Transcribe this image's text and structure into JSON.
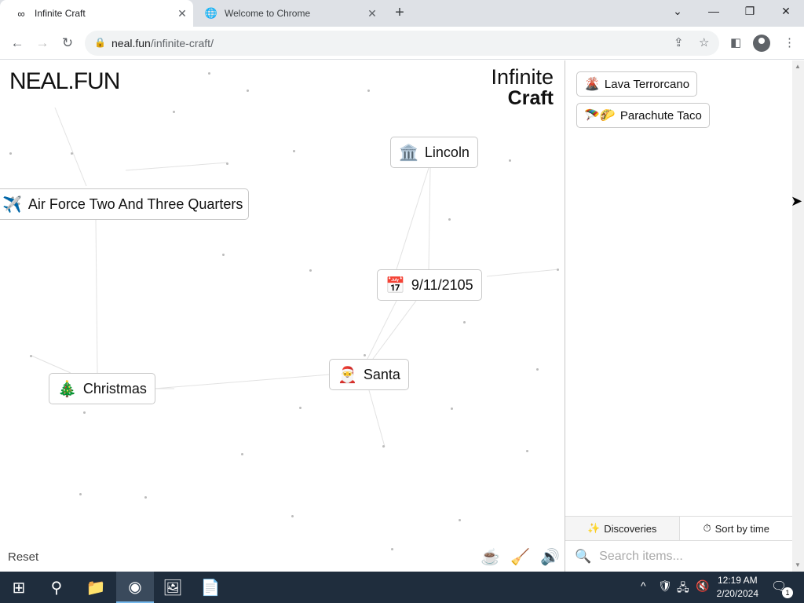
{
  "browser": {
    "tabs": [
      {
        "title": "Infinite Craft",
        "icon": "infinity-icon"
      },
      {
        "title": "Welcome to Chrome",
        "icon": "globe-icon"
      }
    ],
    "url_host": "neal.fun",
    "url_path": "/infinite-craft/"
  },
  "craft": {
    "logo": "NEAL.FUN",
    "title_line1": "Infinite",
    "title_line2": "Craft",
    "items": [
      {
        "label": "Lincoln",
        "emoji": "🏛️"
      },
      {
        "label": "Air Force Two And Three Quarters",
        "emoji": "✈️"
      },
      {
        "label": "9/11/2105",
        "emoji": "📅"
      },
      {
        "label": "Santa",
        "emoji": "🎅"
      },
      {
        "label": "Christmas",
        "emoji": "🎄"
      }
    ],
    "reset_label": "Reset"
  },
  "sidebar": {
    "items": [
      {
        "label": "Lava Terrorcano",
        "emoji": "🌋"
      },
      {
        "label": "Parachute Taco",
        "emoji": "🪂🌮"
      }
    ],
    "tabs": {
      "discoveries": "Discoveries",
      "sort": "Sort by time"
    },
    "search_placeholder": "Search items..."
  },
  "taskbar": {
    "time": "12:19 AM",
    "date": "2/20/2024",
    "notifications": "1"
  },
  "colors": {
    "taskbar_bg": "#1f2d3d",
    "tabstrip_bg": "#dee1e6"
  }
}
